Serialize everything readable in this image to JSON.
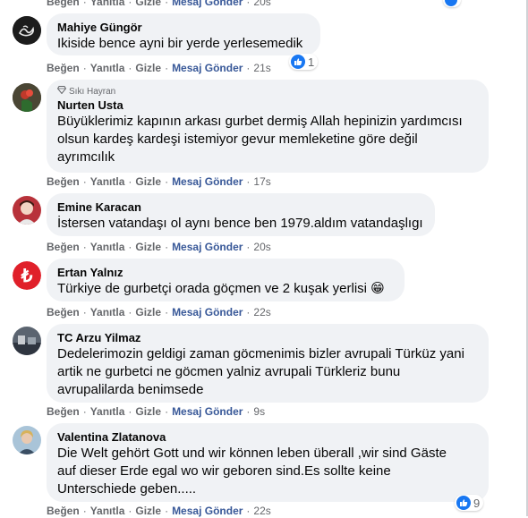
{
  "comments": [
    {
      "author": "",
      "lines": [],
      "actions": {
        "like": "Beğen",
        "reply": "Yanıtla",
        "hide": "Gizle",
        "message": "Mesaj Gönder",
        "time": "20s"
      },
      "reactions": ""
    },
    {
      "author": "Mahiye Güngör",
      "lines": [
        "Ikiside bence ayni bir yerde yerlesemedik"
      ],
      "actions": {
        "like": "Beğen",
        "reply": "Yanıtla",
        "hide": "Gizle",
        "message": "Mesaj Gönder",
        "time": "21s"
      },
      "reactions": "1"
    },
    {
      "badge": "Sıkı Hayran",
      "author": "Nurten Usta",
      "lines": [
        "Büyüklerimiz kapının arkası gurbet dermiş Allah hepinizin yardımcısı",
        "olsun kardeş kardeşi istemiyor gevur memleketine göre değil",
        "ayrımcılık"
      ],
      "actions": {
        "like": "Beğen",
        "reply": "Yanıtla",
        "hide": "Gizle",
        "message": "Mesaj Gönder",
        "time": "17s"
      }
    },
    {
      "author": "Emine Karacan",
      "lines": [
        "İstersen vatandaşı ol aynı bence ben 1979.aldım vatandaşlıgı"
      ],
      "actions": {
        "like": "Beğen",
        "reply": "Yanıtla",
        "hide": "Gizle",
        "message": "Mesaj Gönder",
        "time": "20s"
      }
    },
    {
      "author": "Ertan Yalnız",
      "lines": [
        "Türkiye de gurbetçi orada göçmen ve 2 kuşak yerlisi"
      ],
      "emoji": "😁",
      "actions": {
        "like": "Beğen",
        "reply": "Yanıtla",
        "hide": "Gizle",
        "message": "Mesaj Gönder",
        "time": "22s"
      }
    },
    {
      "author": "TC Arzu Yilmaz",
      "lines": [
        "Dedelerimozin geldigi zaman göcmenimis bizler avrupali Türküz yani",
        "artik ne gurbetci ne göcmen yalniz avrupali Türkleriz bunu",
        "avrupalilarda benimsede"
      ],
      "actions": {
        "like": "Beğen",
        "reply": "Yanıtla",
        "hide": "Gizle",
        "message": "Mesaj Gönder",
        "time": "9s"
      }
    },
    {
      "author": "Valentina Zlatanova",
      "lines": [
        "Die Welt gehört Gott und wir können leben überall ,wir sind Gäste",
        "auf dieser Erde egal wo wir geboren sind.Es sollte keine",
        "Unterschiede geben....."
      ],
      "actions": {
        "like": "Beğen",
        "reply": "Yanıtla",
        "hide": "Gizle",
        "message": "Mesaj Gönder",
        "time": "22s"
      },
      "reactions": "9"
    }
  ],
  "colors": {
    "like_blue": "#1877f2",
    "link_blue": "#385898",
    "bubble": "#f0f2f5",
    "muted": "#65676b"
  }
}
